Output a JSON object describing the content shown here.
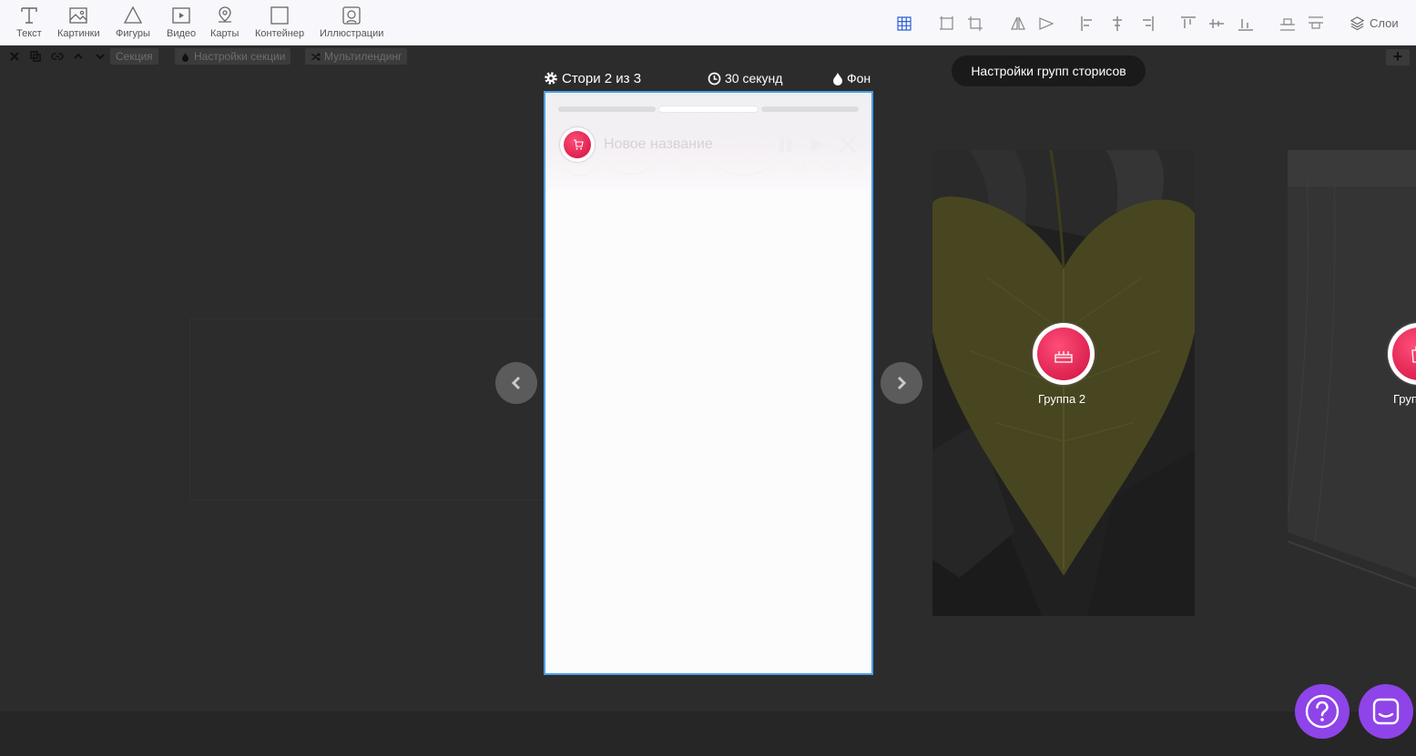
{
  "toolbar": {
    "tools": [
      {
        "label": "Текст",
        "icon": "text-icon"
      },
      {
        "label": "Картинки",
        "icon": "image-icon"
      },
      {
        "label": "Фигуры",
        "icon": "shape-icon"
      },
      {
        "label": "Видео",
        "icon": "video-icon"
      },
      {
        "label": "Карты",
        "icon": "map-pin-icon"
      },
      {
        "label": "Контейнер",
        "icon": "container-icon"
      },
      {
        "label": "Иллюстрации",
        "icon": "illustration-icon"
      }
    ],
    "layers_label": "Слои"
  },
  "section_bar": {
    "section_label": "Секция",
    "section_settings_label": "Настройки секции",
    "multilanding_label": "Мультилендинг",
    "add_label": "+"
  },
  "story": {
    "counter_label": "Стори 2 из 3",
    "duration_label": "30 секунд",
    "background_label": "Фон",
    "title": "Новое название",
    "progress_segments": 3,
    "active_segment": 2
  },
  "groups_settings_label": "Настройки групп сторисов",
  "groups": [
    {
      "label": "Группа 2"
    },
    {
      "label": "Груп"
    }
  ],
  "help": {
    "help_icon": "question-icon",
    "chat_icon": "chat-icon"
  },
  "colors": {
    "accent": "#8e44e8",
    "selection_border": "#4a9ee8",
    "avatar_red": "#e8224f",
    "grid_icon_active": "#2e5fd6"
  }
}
